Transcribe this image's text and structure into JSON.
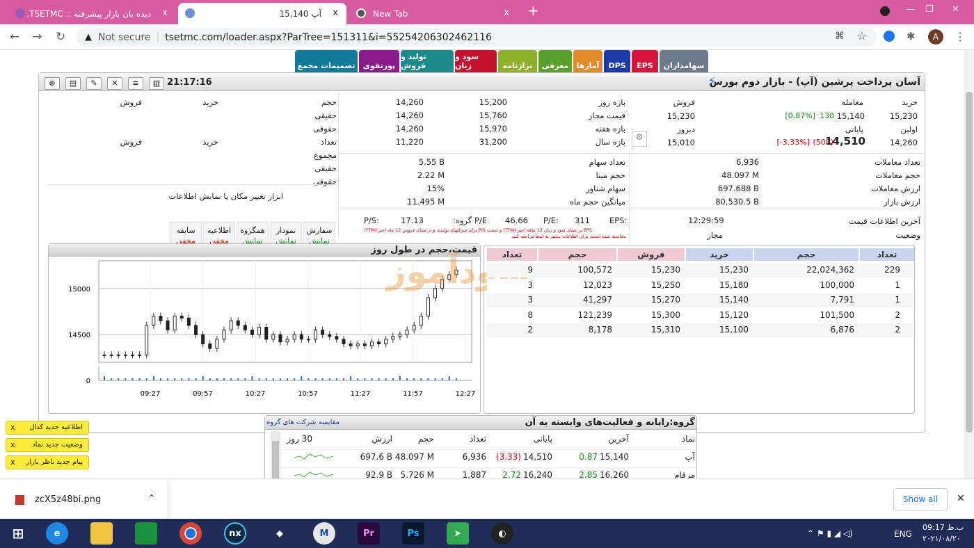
{
  "browser": {
    "tabs": [
      {
        "title": "دیده بان بازار پیشرفته :: TSETMC.",
        "close": "x"
      },
      {
        "title": "آپ 15,140",
        "close": "x"
      },
      {
        "title": "New Tab",
        "close": "x"
      }
    ],
    "new_tab": "+",
    "security": "Not secure",
    "url": "tsetmc.com/loader.aspx?ParTree=151311&i=55254206302462116",
    "avatar": "A"
  },
  "top_tabs": [
    {
      "label": "سهامداران",
      "color": "#6b7b8c"
    },
    {
      "label": "EPS",
      "color": "#d4143a"
    },
    {
      "label": "DPS",
      "color": "#1b3ca8"
    },
    {
      "label": "آمارها",
      "color": "#e08a2a"
    },
    {
      "label": "معرفی",
      "color": "#5aa02c"
    },
    {
      "label": "ترازنامه",
      "color": "#8fb02a"
    },
    {
      "label": "سود و زیان",
      "color": "#c8102e"
    },
    {
      "label": "تولید و فروش",
      "color": "#1d8a8a"
    },
    {
      "label": "پورتفوی",
      "color": "#8b1a8b"
    },
    {
      "label": "تصمیمات مجمع",
      "color": "#137a9a"
    }
  ],
  "header": {
    "title": "آسان پرداخت پرشین (آپ) - بازار دوم بورس",
    "time": "21:17:16"
  },
  "quote": {
    "labels": {
      "buy": "خرید",
      "trade": "معامله",
      "sell": "فروش",
      "first": "اولین",
      "last": "پایانی",
      "yesterday": "دیروز"
    },
    "buy_val": "15,230",
    "trade_pct": "[0.87%]",
    "trade_chg": "130",
    "trade_price": "15,140",
    "sell_val": "15,230",
    "first_val": "14,260",
    "last_pct": "[-3.33%]",
    "last_chg": "(500)",
    "last_price": "14,510",
    "yesterday_val": "15,010",
    "range": [
      {
        "label": "بازه روز",
        "a": "15,200",
        "b": "14,260"
      },
      {
        "label": "قیمت مجاز",
        "a": "15,760",
        "b": "14,260"
      },
      {
        "label": "بازه هفته",
        "a": "15,970",
        "b": "14,260"
      },
      {
        "label": "بازه سال",
        "a": "31,200",
        "b": "11,220"
      }
    ],
    "stats_left": [
      {
        "label": "تعداد معاملات",
        "val": "6,936"
      },
      {
        "label": "حجم معاملات",
        "val": "48.097 M"
      },
      {
        "label": "ارزش معاملات",
        "val": "697.688 B"
      },
      {
        "label": "ارزش بازار",
        "val": "80,530.5 B"
      }
    ],
    "stats_mid": [
      {
        "label": "تعداد سهام",
        "val": "5.55 B"
      },
      {
        "label": "حجم مبنا",
        "val": "2.22 M"
      },
      {
        "label": "سهام شناور",
        "val": "15%"
      },
      {
        "label": "میانگین حجم ماه",
        "val": "11.495 M"
      }
    ],
    "eps": {
      "eps_label": "EPS:",
      "eps_val": "311",
      "pe_label": "P/E:",
      "pe_val": "46.66",
      "gpe_label": "P/E گروه:",
      "gpe_val": "17.13",
      "ps_label": "P/S:",
      "note1": "EPS بر مبنای سود و زیان 12 ماهه اخیر (TTM) و نسبت P/S برای شرکتهای تولیدی و بر مبنای فروش 12 ماه اخیر (TTM)",
      "note2": "محاسبه شده است، برای اطلاعات بیشتر به اینجا مراجعه کنید."
    },
    "last_info": {
      "label": "آخرین اطلاعات قیمت",
      "val": "12:29:59",
      "status_label": "وضعیت",
      "status_val": "مجاز"
    },
    "client_labels": {
      "buy": "خرید",
      "sell": "فروش",
      "vol": "حجم",
      "real": "حقیقی",
      "legal": "حقوقی",
      "count": "تعداد",
      "total": "مجموع"
    },
    "tools_title": "ابزار تغییر مکان یا نمایش اطلاعات",
    "tool_btns": [
      {
        "l1": "سفارش",
        "l2": "نمایش",
        "state": "on"
      },
      {
        "l1": "نمودار",
        "l2": "نمایش",
        "state": "on"
      },
      {
        "l1": "همگروه",
        "l2": "نمایش",
        "state": "on"
      },
      {
        "l1": "اطلاعیه",
        "l2": "مخفی",
        "state": "off"
      },
      {
        "l1": "سابقه",
        "l2": "مخفی",
        "state": "off"
      }
    ]
  },
  "orderbook": {
    "headers": [
      "تعداد",
      "حجم",
      "خرید",
      "فروش",
      "حجم",
      "تعداد"
    ],
    "rows": [
      [
        "229",
        "22,024,362",
        "15,230",
        "15,230",
        "100,572",
        "9"
      ],
      [
        "1",
        "100,000",
        "15,180",
        "15,250",
        "12,023",
        "3"
      ],
      [
        "1",
        "7,791",
        "15,140",
        "15,270",
        "41,297",
        "3"
      ],
      [
        "2",
        "101,500",
        "15,120",
        "15,300",
        "121,239",
        "8"
      ],
      [
        "2",
        "6,876",
        "15,100",
        "15,310",
        "8,178",
        "2"
      ]
    ],
    "watermark": "سودآموز"
  },
  "chart_title": "قیمت،حجم در طول روز",
  "chart_data": {
    "type": "candlestick",
    "title": "قیمت،حجم در طول روز",
    "x_ticks": [
      "09:27",
      "09:57",
      "10:27",
      "10:57",
      "11:27",
      "11:57",
      "12:27"
    ],
    "y_ticks": [
      "15000",
      "14500",
      "0"
    ],
    "ylim": [
      14200,
      15300
    ],
    "gridlines": true,
    "series": [
      {
        "values": [
          14280,
          14280,
          14280,
          14280,
          14280,
          14280,
          14600,
          14700,
          14650,
          14550,
          14700,
          14680,
          14600,
          14500,
          14400,
          14350,
          14450,
          14550,
          14650,
          14600,
          14550,
          14500,
          14580,
          14450,
          14500,
          14420,
          14450,
          14500,
          14450,
          14450,
          14550,
          14500,
          14480,
          14450,
          14400,
          14380,
          14400,
          14380,
          14420,
          14400,
          14450,
          14480,
          14500,
          14550,
          14600,
          14700,
          14900,
          15000,
          15100,
          15150,
          15200
        ]
      }
    ]
  },
  "group": {
    "title": "گروه:رایانه و فعالیت‌های وابسته به آن",
    "compare": "مقایسه شرکت های گروه",
    "headers": [
      "نماد",
      "آخرین",
      "",
      "پایانی",
      "",
      "تعداد",
      "حجم",
      "ارزش",
      "30 روز"
    ],
    "rows": [
      [
        "آپ",
        "15,140",
        "0.87",
        "14,510",
        "(3.33)",
        "6,936",
        "48.097 M",
        "697.6 B"
      ],
      [
        "مرقام",
        "16,260",
        "2.85",
        "16,240",
        "2.72",
        "1,887",
        "5.726 M",
        "92.9 B"
      ]
    ]
  },
  "notices": [
    {
      "text": "اطلاعیه جدید کدال",
      "x": "x"
    },
    {
      "text": "وضعیت جدید نماد",
      "x": "x"
    },
    {
      "text": "پیام جدید ناظر بازار",
      "x": "x"
    }
  ],
  "download": {
    "file": "zcX5z48bi.png",
    "show_all": "Show all",
    "close": "✕"
  },
  "taskbar": {
    "lang": "ENG",
    "time": "09:17 ب.ظ",
    "date": "۲۰۲۱/۰۸/۲۰"
  }
}
